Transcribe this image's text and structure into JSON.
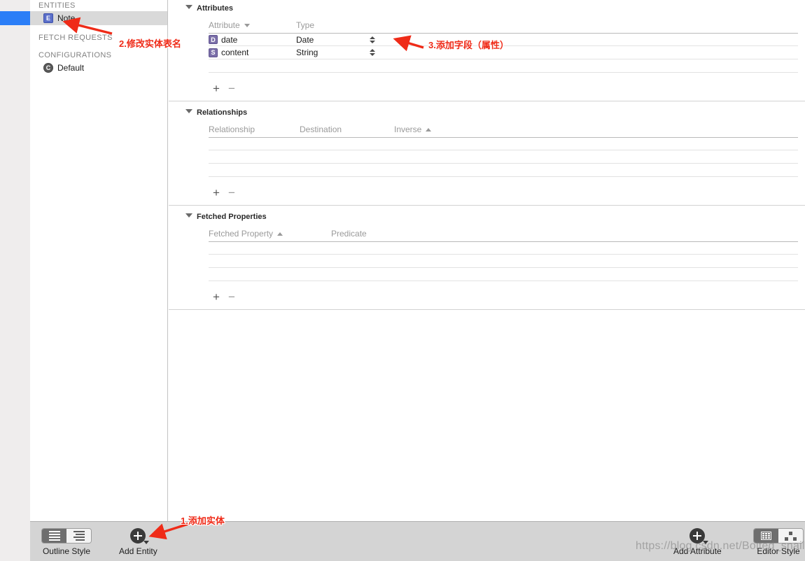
{
  "sidebar": {
    "groups": [
      {
        "label": "ENTITIES",
        "items": [
          {
            "badge": "E",
            "label": "Note",
            "selected": true
          }
        ]
      },
      {
        "label": "FETCH REQUESTS",
        "items": []
      },
      {
        "label": "CONFIGURATIONS",
        "items": [
          {
            "badge": "C",
            "label": "Default",
            "selected": false
          }
        ]
      }
    ]
  },
  "editor": {
    "attributes": {
      "title": "Attributes",
      "columns": {
        "name": "Attribute",
        "type": "Type"
      },
      "sort": "descending",
      "rows": [
        {
          "badge": "D",
          "name": "date",
          "type": "Date"
        },
        {
          "badge": "S",
          "name": "content",
          "type": "String"
        }
      ],
      "add_label": "+",
      "remove_label": "−"
    },
    "relationships": {
      "title": "Relationships",
      "columns": {
        "name": "Relationship",
        "destination": "Destination",
        "inverse": "Inverse"
      },
      "sort": "ascending",
      "rows": [],
      "add_label": "+",
      "remove_label": "−"
    },
    "fetched_properties": {
      "title": "Fetched Properties",
      "columns": {
        "name": "Fetched Property",
        "predicate": "Predicate"
      },
      "sort": "ascending",
      "rows": [],
      "add_label": "+",
      "remove_label": "−"
    }
  },
  "toolbar": {
    "outline_style_label": "Outline Style",
    "add_entity_label": "Add Entity",
    "add_attribute_label": "Add Attribute",
    "editor_style_label": "Editor Style"
  },
  "annotations": [
    {
      "id": "step1",
      "text": "1.添加实体"
    },
    {
      "id": "step2",
      "text": "2.修改实体表名"
    },
    {
      "id": "step3",
      "text": "3.添加字段（属性）"
    }
  ],
  "watermark": {
    "text": "https://blog.csdn.net/Bolted_snail"
  },
  "colors": {
    "annotation_red": "#ef2b18",
    "selection_blue": "#2b7ef7",
    "entity_badge": "#5b6fc9",
    "attribute_badge": "#7b6fa8"
  }
}
